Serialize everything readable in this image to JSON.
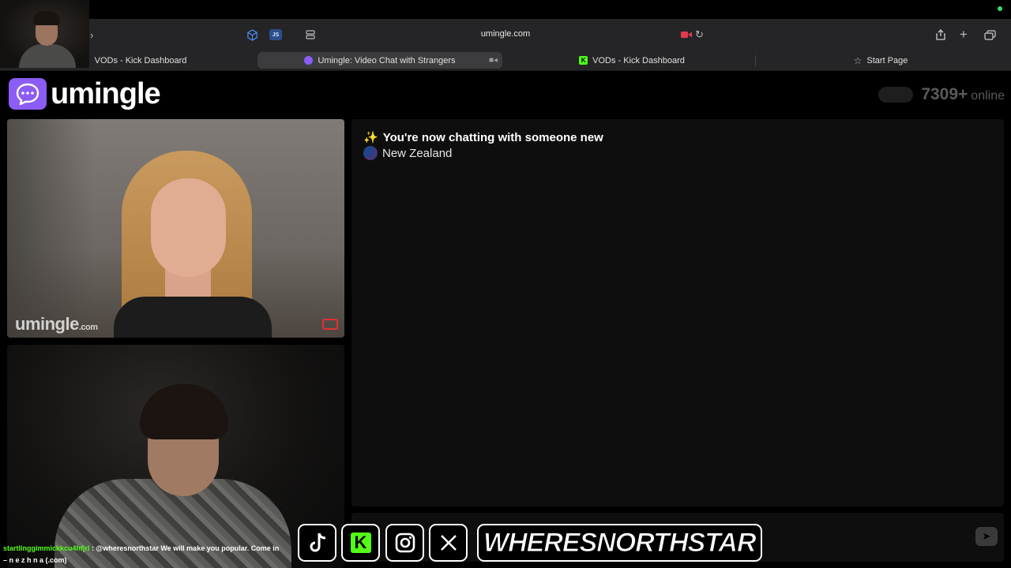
{
  "browser": {
    "url": "umingle.com",
    "tabs": [
      {
        "label": "VODs - Kick Dashboard"
      },
      {
        "label": "Umingle: Video Chat with Strangers"
      },
      {
        "label": "VODs - Kick Dashboard"
      },
      {
        "label": "Start Page"
      }
    ],
    "extensions": [
      {
        "label": "JS"
      }
    ]
  },
  "site": {
    "logo_text": "umingle",
    "online_count": "7309+",
    "online_label": "online",
    "accent_color": "#8b5cf6"
  },
  "stranger_video": {
    "watermark_main": "umingle",
    "watermark_suffix": ".com"
  },
  "chat": {
    "status_message": "You're now chatting with someone new",
    "stranger_country": "New Zealand"
  },
  "overlay": {
    "channel_name": "WHERESNORTHSTAR",
    "socials": [
      {
        "name": "tiktok-icon"
      },
      {
        "name": "kick-icon",
        "glyph": "K"
      },
      {
        "name": "instagram-icon"
      },
      {
        "name": "x-icon"
      }
    ],
    "kick_chat": {
      "username": "startlinggimmickkcu4hfjrl",
      "message": ": @wheresnorthstar We will make you popular. Come in",
      "continuation": "– n e z h n a (.com)"
    }
  }
}
